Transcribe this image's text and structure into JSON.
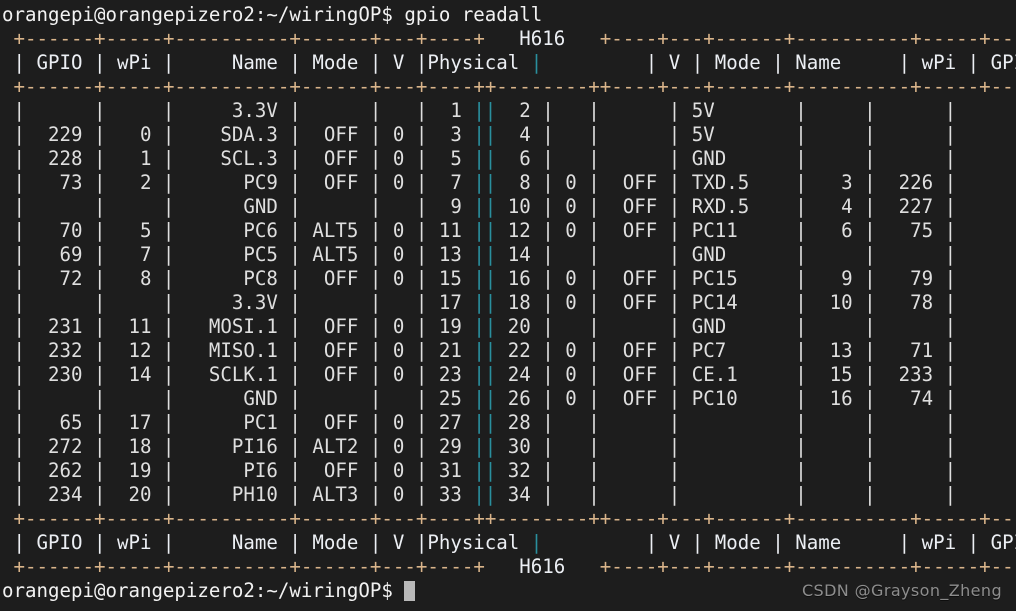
{
  "terminal": {
    "background_color": "#1d1d1d",
    "foreground_color": "#e8e8e8",
    "rule_color": "#d9b48a",
    "separator_color": "#2a8f9e",
    "cursor_color": "#b9b9b9"
  },
  "prompt": {
    "top": "orangepi@orangepizero2:~/wiringOP$ gpio readall",
    "bottom": "orangepi@orangepizero2:~/wiringOP$ "
  },
  "command": "gpio readall",
  "watermark": "CSDN @Grayson_Zheng",
  "table": {
    "chip": "H616",
    "columns_left": [
      "GPIO",
      "wPi",
      "Name",
      "Mode",
      "V",
      "Physical"
    ],
    "columns_right": [
      "V",
      "Mode",
      "Name",
      "wPi",
      "GPIO"
    ],
    "rule_outer": "+------+-----+----------+------+---+----+",
    "rows": [
      {
        "gpio_l": "",
        "wpi_l": "",
        "name_l": "3.3V",
        "mode_l": "",
        "v_l": "",
        "phys_l": "1",
        "phys_r": "2",
        "v_r": "",
        "mode_r": "",
        "name_r": "5V",
        "wpi_r": "",
        "gpio_r": ""
      },
      {
        "gpio_l": "229",
        "wpi_l": "0",
        "name_l": "SDA.3",
        "mode_l": "OFF",
        "v_l": "0",
        "phys_l": "3",
        "phys_r": "4",
        "v_r": "",
        "mode_r": "",
        "name_r": "5V",
        "wpi_r": "",
        "gpio_r": ""
      },
      {
        "gpio_l": "228",
        "wpi_l": "1",
        "name_l": "SCL.3",
        "mode_l": "OFF",
        "v_l": "0",
        "phys_l": "5",
        "phys_r": "6",
        "v_r": "",
        "mode_r": "",
        "name_r": "GND",
        "wpi_r": "",
        "gpio_r": ""
      },
      {
        "gpio_l": "73",
        "wpi_l": "2",
        "name_l": "PC9",
        "mode_l": "OFF",
        "v_l": "0",
        "phys_l": "7",
        "phys_r": "8",
        "v_r": "0",
        "mode_r": "OFF",
        "name_r": "TXD.5",
        "wpi_r": "3",
        "gpio_r": "226"
      },
      {
        "gpio_l": "",
        "wpi_l": "",
        "name_l": "GND",
        "mode_l": "",
        "v_l": "",
        "phys_l": "9",
        "phys_r": "10",
        "v_r": "0",
        "mode_r": "OFF",
        "name_r": "RXD.5",
        "wpi_r": "4",
        "gpio_r": "227"
      },
      {
        "gpio_l": "70",
        "wpi_l": "5",
        "name_l": "PC6",
        "mode_l": "ALT5",
        "v_l": "0",
        "phys_l": "11",
        "phys_r": "12",
        "v_r": "0",
        "mode_r": "OFF",
        "name_r": "PC11",
        "wpi_r": "6",
        "gpio_r": "75"
      },
      {
        "gpio_l": "69",
        "wpi_l": "7",
        "name_l": "PC5",
        "mode_l": "ALT5",
        "v_l": "0",
        "phys_l": "13",
        "phys_r": "14",
        "v_r": "",
        "mode_r": "",
        "name_r": "GND",
        "wpi_r": "",
        "gpio_r": ""
      },
      {
        "gpio_l": "72",
        "wpi_l": "8",
        "name_l": "PC8",
        "mode_l": "OFF",
        "v_l": "0",
        "phys_l": "15",
        "phys_r": "16",
        "v_r": "0",
        "mode_r": "OFF",
        "name_r": "PC15",
        "wpi_r": "9",
        "gpio_r": "79"
      },
      {
        "gpio_l": "",
        "wpi_l": "",
        "name_l": "3.3V",
        "mode_l": "",
        "v_l": "",
        "phys_l": "17",
        "phys_r": "18",
        "v_r": "0",
        "mode_r": "OFF",
        "name_r": "PC14",
        "wpi_r": "10",
        "gpio_r": "78"
      },
      {
        "gpio_l": "231",
        "wpi_l": "11",
        "name_l": "MOSI.1",
        "mode_l": "OFF",
        "v_l": "0",
        "phys_l": "19",
        "phys_r": "20",
        "v_r": "",
        "mode_r": "",
        "name_r": "GND",
        "wpi_r": "",
        "gpio_r": ""
      },
      {
        "gpio_l": "232",
        "wpi_l": "12",
        "name_l": "MISO.1",
        "mode_l": "OFF",
        "v_l": "0",
        "phys_l": "21",
        "phys_r": "22",
        "v_r": "0",
        "mode_r": "OFF",
        "name_r": "PC7",
        "wpi_r": "13",
        "gpio_r": "71"
      },
      {
        "gpio_l": "230",
        "wpi_l": "14",
        "name_l": "SCLK.1",
        "mode_l": "OFF",
        "v_l": "0",
        "phys_l": "23",
        "phys_r": "24",
        "v_r": "0",
        "mode_r": "OFF",
        "name_r": "CE.1",
        "wpi_r": "15",
        "gpio_r": "233"
      },
      {
        "gpio_l": "",
        "wpi_l": "",
        "name_l": "GND",
        "mode_l": "",
        "v_l": "",
        "phys_l": "25",
        "phys_r": "26",
        "v_r": "0",
        "mode_r": "OFF",
        "name_r": "PC10",
        "wpi_r": "16",
        "gpio_r": "74"
      },
      {
        "gpio_l": "65",
        "wpi_l": "17",
        "name_l": "PC1",
        "mode_l": "OFF",
        "v_l": "0",
        "phys_l": "27",
        "phys_r": "28",
        "v_r": "",
        "mode_r": "",
        "name_r": "",
        "wpi_r": "",
        "gpio_r": ""
      },
      {
        "gpio_l": "272",
        "wpi_l": "18",
        "name_l": "PI16",
        "mode_l": "ALT2",
        "v_l": "0",
        "phys_l": "29",
        "phys_r": "30",
        "v_r": "",
        "mode_r": "",
        "name_r": "",
        "wpi_r": "",
        "gpio_r": ""
      },
      {
        "gpio_l": "262",
        "wpi_l": "19",
        "name_l": "PI6",
        "mode_l": "OFF",
        "v_l": "0",
        "phys_l": "31",
        "phys_r": "32",
        "v_r": "",
        "mode_r": "",
        "name_r": "",
        "wpi_r": "",
        "gpio_r": ""
      },
      {
        "gpio_l": "234",
        "wpi_l": "20",
        "name_l": "PH10",
        "mode_l": "ALT3",
        "v_l": "0",
        "phys_l": "33",
        "phys_r": "34",
        "v_r": "",
        "mode_r": "",
        "name_r": "",
        "wpi_r": "",
        "gpio_r": ""
      }
    ]
  }
}
